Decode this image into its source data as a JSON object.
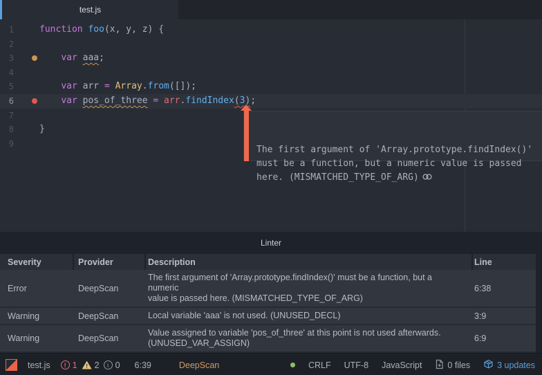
{
  "tab_bar": {
    "active_tab": "test.js"
  },
  "editor": {
    "lines": [
      {
        "n": "1",
        "tokens": [
          {
            "t": "function",
            "c": "kw"
          },
          {
            "t": " ",
            "c": "pl"
          },
          {
            "t": "foo",
            "c": "fn"
          },
          {
            "t": "(x, y, z) {",
            "c": "pl"
          }
        ]
      },
      {
        "n": "2",
        "tokens": []
      },
      {
        "n": "3",
        "marker": "warn",
        "tokens": [
          {
            "t": "    ",
            "c": "pl"
          },
          {
            "t": "var",
            "c": "kw"
          },
          {
            "t": " ",
            "c": "pl"
          },
          {
            "t": "aaa",
            "c": "pl",
            "u": "warn"
          },
          {
            "t": ";",
            "c": "pl"
          }
        ]
      },
      {
        "n": "4",
        "tokens": []
      },
      {
        "n": "5",
        "tokens": [
          {
            "t": "    ",
            "c": "pl"
          },
          {
            "t": "var",
            "c": "kw"
          },
          {
            "t": " ",
            "c": "pl"
          },
          {
            "t": "arr",
            "c": "pl"
          },
          {
            "t": " ",
            "c": "pl"
          },
          {
            "t": "=",
            "c": "kw"
          },
          {
            "t": " ",
            "c": "pl"
          },
          {
            "t": "Array",
            "c": "cls"
          },
          {
            "t": ".",
            "c": "pl"
          },
          {
            "t": "from",
            "c": "fn"
          },
          {
            "t": "([]);",
            "c": "pl"
          }
        ]
      },
      {
        "n": "6",
        "marker": "err",
        "current": true,
        "tokens": [
          {
            "t": "    ",
            "c": "pl"
          },
          {
            "t": "var",
            "c": "kw"
          },
          {
            "t": " ",
            "c": "pl"
          },
          {
            "t": "pos_of_three",
            "c": "pl",
            "u": "warn"
          },
          {
            "t": " ",
            "c": "pl"
          },
          {
            "t": "=",
            "c": "kw"
          },
          {
            "t": " ",
            "c": "pl"
          },
          {
            "t": "arr",
            "c": "red"
          },
          {
            "t": ".",
            "c": "pl"
          },
          {
            "t": "findIndex",
            "c": "fn"
          },
          {
            "t": "(",
            "c": "pl",
            "u": "err"
          },
          {
            "t": "3",
            "c": "num",
            "u": "err"
          },
          {
            "t": ")",
            "c": "pl",
            "u": "err"
          },
          {
            "t": ";",
            "c": "pl"
          }
        ]
      },
      {
        "n": "7",
        "tokens": []
      },
      {
        "n": "8",
        "tokens": [
          {
            "t": "}",
            "c": "pl"
          }
        ]
      },
      {
        "n": "9",
        "tokens": []
      }
    ],
    "tooltip": {
      "text": "The first argument of 'Array.prototype.findIndex()'\nmust be a function, but a numeric value is passed\nhere. (MISMATCHED_TYPE_OF_ARG)"
    }
  },
  "linter_panel": {
    "title": "Linter",
    "columns": [
      "Severity",
      "Provider",
      "Description",
      "Line"
    ],
    "rows": [
      {
        "severity": "Error",
        "provider": "DeepScan",
        "description": "The first argument of 'Array.prototype.findIndex()' must be a function, but a numeric\nvalue is passed here. (MISMATCHED_TYPE_OF_ARG)",
        "line": "6:38"
      },
      {
        "severity": "Warning",
        "provider": "DeepScan",
        "description": "Local variable 'aaa' is not used. (UNUSED_DECL)",
        "line": "3:9"
      },
      {
        "severity": "Warning",
        "provider": "DeepScan",
        "description": "Value assigned to variable 'pos_of_three' at this point is not used afterwards.\n(UNUSED_VAR_ASSIGN)",
        "line": "6:9"
      }
    ]
  },
  "status_bar": {
    "file": "test.js",
    "errors": "1",
    "warnings": "2",
    "infos": "0",
    "cursor": "6:39",
    "provider": "DeepScan",
    "line_ending": "CRLF",
    "encoding": "UTF-8",
    "language": "JavaScript",
    "files": "0 files",
    "updates": "3 updates"
  },
  "colors": {
    "accent_blue": "#5a9fe0",
    "error_red": "#e4574b",
    "warning_orange": "#cc9552",
    "deepscan_orange": "#d19a66",
    "updates_blue": "#5c9fd8"
  }
}
